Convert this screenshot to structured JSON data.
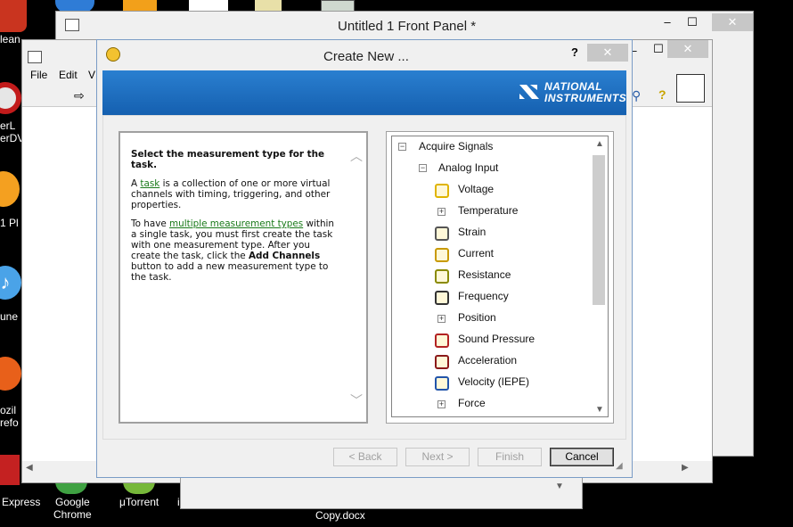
{
  "desktop": {
    "left_icon_labels": [
      "lean",
      "erL",
      "erDV",
      "1 Pl",
      "une",
      "ozil",
      "refo"
    ],
    "bottom_icons": [
      {
        "label": "Express"
      },
      {
        "label": "Google\nChrome"
      },
      {
        "label": "μTorrent"
      },
      {
        "label": "Copy.docx"
      }
    ]
  },
  "front_panel": {
    "title": "Untitled 1 Front Panel *",
    "minimize": "–",
    "maximize": "☐",
    "close": "✕"
  },
  "back_window": {
    "menu": [
      "File",
      "Edit",
      "V"
    ],
    "minimize": "–",
    "maximize": "☐",
    "close": "✕"
  },
  "dialog": {
    "title": "Create New ...",
    "help": "?",
    "close": "✕",
    "brand_line1": "NATIONAL",
    "brand_line2": "INSTRUMENTS",
    "colors": {
      "banner": "#1a6fc0",
      "link": "#1a7a1a"
    },
    "description": {
      "heading": "Select the measurement type for the task.",
      "p1_pre": "A ",
      "p1_link": "task",
      "p1_post": " is a collection of one or more virtual channels with timing, triggering, and other properties.",
      "p2_pre": "To have ",
      "p2_link": "multiple measurement types",
      "p2_mid": " within a single task, you must first create the task with one measurement type. After you create the task, click the ",
      "p2_bold": "Add Channels",
      "p2_post": " button to add a new measurement type to the task."
    },
    "tree": {
      "root": "Acquire Signals",
      "group": "Analog Input",
      "items": [
        {
          "label": "Voltage",
          "icon": "voltage-icon",
          "expandable": false
        },
        {
          "label": "Temperature",
          "icon": "",
          "expandable": true
        },
        {
          "label": "Strain",
          "icon": "strain-icon",
          "expandable": false
        },
        {
          "label": "Current",
          "icon": "current-icon",
          "expandable": false
        },
        {
          "label": "Resistance",
          "icon": "resistance-icon",
          "expandable": false
        },
        {
          "label": "Frequency",
          "icon": "frequency-icon",
          "expandable": false
        },
        {
          "label": "Position",
          "icon": "",
          "expandable": true
        },
        {
          "label": "Sound Pressure",
          "icon": "microphone-icon",
          "expandable": false
        },
        {
          "label": "Acceleration",
          "icon": "acceleration-icon",
          "expandable": false
        },
        {
          "label": "Velocity (IEPE)",
          "icon": "velocity-icon",
          "expandable": false
        },
        {
          "label": "Force",
          "icon": "",
          "expandable": true
        }
      ]
    },
    "buttons": {
      "back": "< Back",
      "next": "Next >",
      "finish": "Finish",
      "cancel": "Cancel"
    }
  }
}
